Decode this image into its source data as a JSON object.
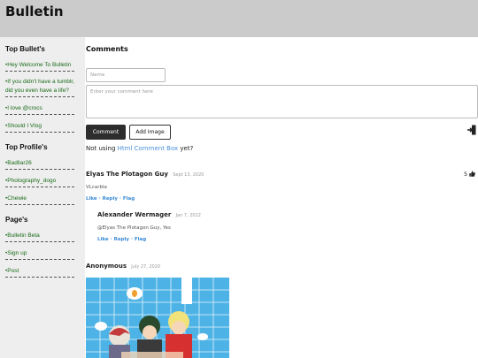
{
  "header": {
    "title": "Bulletin"
  },
  "sidebar": {
    "top_bullets_title": "Top Bullet's",
    "top_bullets": [
      "•Hey Welcome To Bulletin",
      "•If you didn't have a tumblr, did you even have a life?",
      "•I love @crocs",
      "•Should I Vlog"
    ],
    "top_profiles_title": "Top Profile's",
    "top_profiles": [
      "•Badliar26",
      "•Photography_dogo",
      "•Chewie"
    ],
    "pages_title": "Page's",
    "pages": [
      "•Bulletin Beta",
      "•Sign up",
      "•Post"
    ]
  },
  "comments": {
    "title": "Comments",
    "name_placeholder": "Name",
    "comment_placeholder": "Enter your comment here",
    "comment_button": "Comment",
    "add_image_button": "Add Image",
    "not_using_prefix": "Not using",
    "not_using_link": "Html Comment Box",
    "not_using_suffix": "yet?",
    "items": [
      {
        "author": "Elyas The Plotagon Guy",
        "date": "Sept 13, 2020",
        "body": "VLcarbla",
        "votes": "5",
        "actions": {
          "like": "Like",
          "reply": "Reply",
          "flag": "Flag",
          "sep": "·"
        }
      },
      {
        "author": "Alexander Wermager",
        "date": "Jan 7, 2022",
        "body": "@Elyas The Plotagon Guy, Yes",
        "actions": {
          "like": "Like",
          "reply": "Reply",
          "flag": "Flag",
          "sep": "·"
        }
      },
      {
        "author": "Anonymous",
        "date": "July 27, 2020"
      }
    ]
  },
  "colors": {
    "header_bg": "#cbcbcb",
    "sidebar_bg": "#eeeeee",
    "sidebar_link": "#1a6b1a",
    "action_link": "#3a8ad6",
    "comment_button_bg": "#2d2d2d"
  },
  "icons": {
    "signin": "sign-in-icon",
    "thumbs_up": "thumbs-up-icon"
  }
}
